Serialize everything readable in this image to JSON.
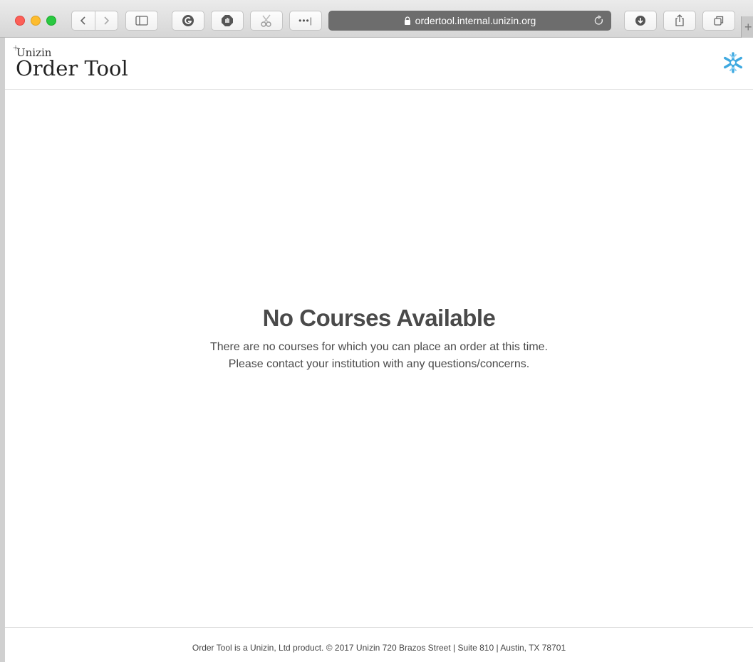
{
  "browser": {
    "url": "ordertool.internal.unizin.org",
    "more_label": "•••|"
  },
  "app": {
    "brand_small": "Unizin",
    "brand_large": "Order Tool"
  },
  "empty_state": {
    "title": "No Courses Available",
    "line1": "There are no courses for which you can place an order at this time.",
    "line2": "Please contact your institution with any questions/concerns."
  },
  "footer": {
    "text": "Order Tool is a Unizin, Ltd product. © 2017 Unizin 720 Brazos Street | Suite 810 | Austin, TX 78701"
  },
  "icons": {
    "settings": "snowflake-gear-icon",
    "back": "chevron-left-icon",
    "forward": "chevron-right-icon",
    "sidebar": "sidebar-icon",
    "grammarly": "grammarly-icon",
    "adblock": "adblock-icon",
    "extension": "scissors-icon",
    "lock": "lock-icon",
    "reload": "reload-icon",
    "download": "download-icon",
    "share": "share-icon",
    "tabs": "tabs-icon"
  },
  "colors": {
    "accent": "#3fa9e0",
    "text": "#4a4a4a",
    "address_bar": "#6d6d6d"
  }
}
